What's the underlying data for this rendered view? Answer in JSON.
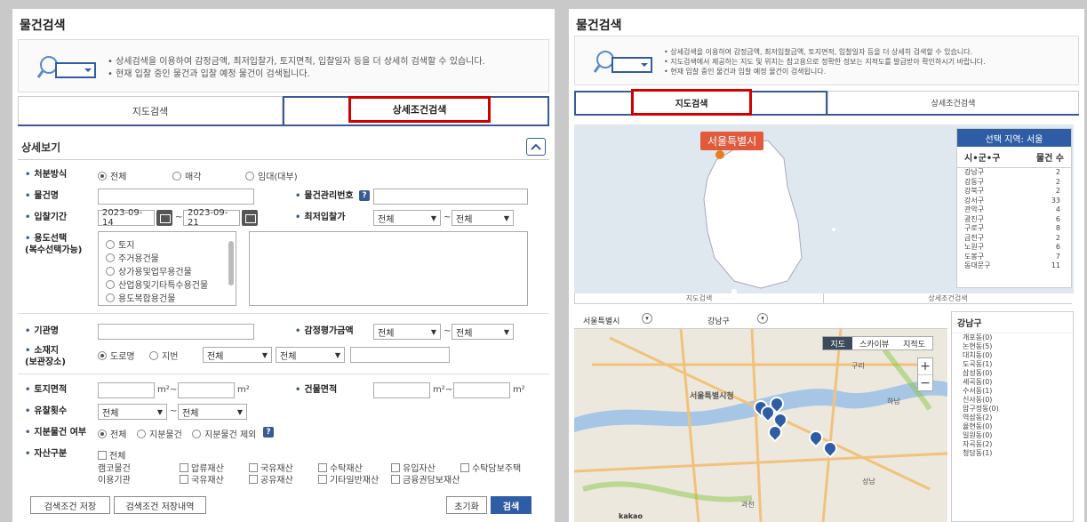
{
  "left": {
    "title": "물건검색",
    "info": [
      "• 상세검색을 이용하여 감정금액, 최저입찰가, 토지면적, 입찰일자 등을 더 상세히 검색할 수 있습니다.",
      "• 현재 입찰 중인 물건과 입찰 예정 물건이 검색됩니다."
    ],
    "tabs": {
      "map": "지도검색",
      "detail": "상세조건검색"
    },
    "section_title": "상세보기",
    "fields": {
      "disposal": "처분방식",
      "disposal_opts": [
        "전체",
        "매각",
        "임대(대부)"
      ],
      "item_name": "물건명",
      "mgmt_no": "물건관리번호",
      "bid_period": "입찰기간",
      "date_from": "2023-09-14",
      "date_to": "2023-09-21",
      "min_bid": "최저입찰가",
      "all": "전체",
      "usage": "용도선택",
      "usage_note": "(복수선택가능)",
      "usage_items": [
        "토지",
        "주거용건물",
        "상가용및업무용건물",
        "산업용및기타특수용건물",
        "용도복합용건물"
      ],
      "agency": "기관명",
      "appraisal": "감정평가금액",
      "location": "소재지",
      "location_note": "(보관장소)",
      "road": "도로명",
      "lot": "지번",
      "land_area": "토지면적",
      "building_area": "건물면적",
      "unit": "m²",
      "fail_count": "유찰횟수",
      "share": "지분물건 여부",
      "share_opts": [
        "전체",
        "지분물건",
        "지분물건 제외"
      ],
      "asset": "자산구분",
      "asset_all": "전체",
      "campaign": "캠코물건",
      "agency_use": "이용기관",
      "asset_row1": [
        "압류재산",
        "국유재산",
        "수탁재산",
        "유입자산",
        "수탁담보주택"
      ],
      "asset_row2": [
        "국유재산",
        "공유재산",
        "기타일반재산",
        "금융권담보재산"
      ],
      "tilde": "~",
      "help": "?"
    },
    "buttons": {
      "save": "검색조건 저장",
      "history": "검색조건 저장내역",
      "reset": "초기화",
      "search": "검색"
    }
  },
  "right": {
    "title": "물건검색",
    "info": [
      "• 상세검색을 이용하여 감정금액, 최저입찰금액, 토지면적, 입찰일자 등을 더 상세히 검색할 수 있습니다.",
      "• 지도검색에서 제공하는 지도 및 위치는 참고용으로 정확한 정보는 지적도를 발급받아 확인하시기 바랍니다.",
      "• 현재 입찰 중인 물건과 입찰 예정 물건이 검색됩니다."
    ],
    "tabs": {
      "map": "지도검색",
      "detail": "상세조건검색"
    },
    "selected_region": "서울특별시",
    "region_header": "선택 지역: 서울",
    "region_cols": [
      "시•군•구",
      "물건 수"
    ],
    "regions": [
      {
        "name": "강남구",
        "count": "2"
      },
      {
        "name": "강동구",
        "count": "2"
      },
      {
        "name": "강북구",
        "count": "2"
      },
      {
        "name": "강서구",
        "count": "33"
      },
      {
        "name": "관악구",
        "count": "4"
      },
      {
        "name": "광진구",
        "count": "6"
      },
      {
        "name": "구로구",
        "count": "8"
      },
      {
        "name": "금천구",
        "count": "2"
      },
      {
        "name": "노원구",
        "count": "6"
      },
      {
        "name": "도봉구",
        "count": "7"
      },
      {
        "name": "동대문구",
        "count": "11"
      }
    ],
    "sub_tabs": {
      "map": "지도검색",
      "detail": "상세조건검색"
    },
    "map_city": "서울특별시",
    "map_district": "강남구",
    "map_types": [
      "지도",
      "스카이뷰",
      "지적도"
    ],
    "map_labels": [
      "서울특별시청",
      "구리",
      "하남",
      "성남",
      "과천",
      "kakao"
    ],
    "dong_title": "강남구",
    "dongs": [
      "개포동(0)",
      "논현동(5)",
      "대치동(0)",
      "도곡동(1)",
      "삼성동(0)",
      "세곡동(0)",
      "수서동(1)",
      "신사동(0)",
      "압구정동(0)",
      "역삼동(2)",
      "율현동(0)",
      "일원동(0)",
      "자곡동(2)",
      "청담동(1)"
    ]
  }
}
